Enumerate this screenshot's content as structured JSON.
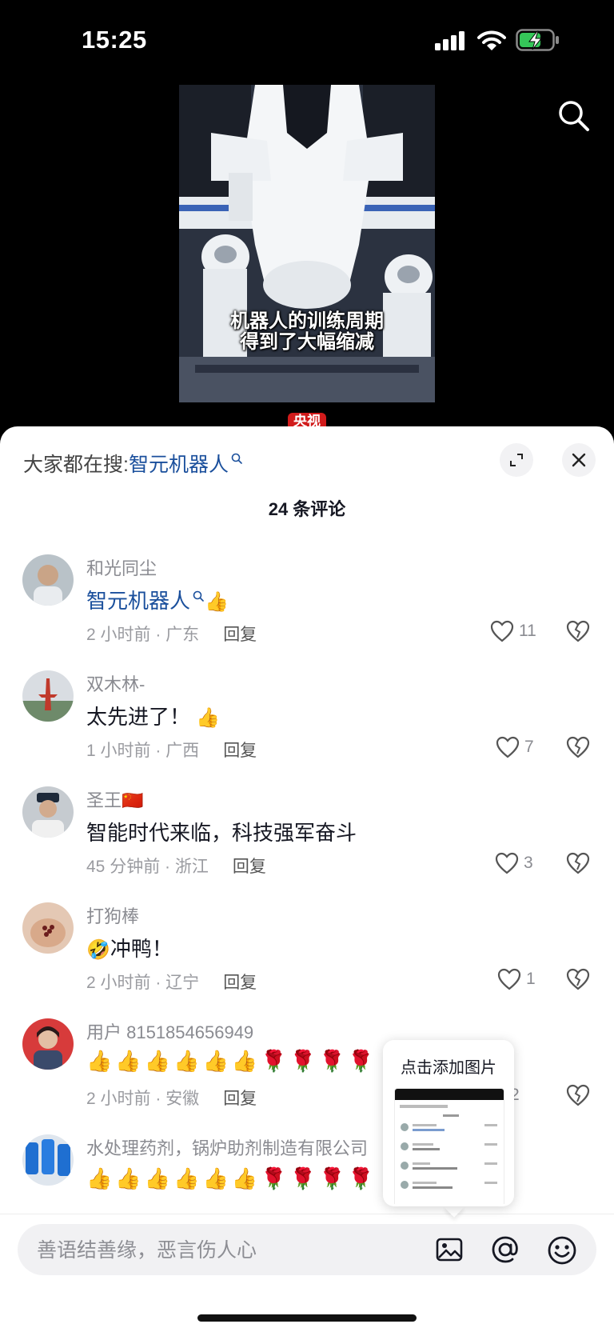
{
  "status_bar": {
    "time": "15:25"
  },
  "video": {
    "caption_line1": "机器人的训练周期",
    "caption_line2": "得到了大幅缩减",
    "source_badge": "央视"
  },
  "sheet": {
    "hot_search_prefix": "大家都在搜:",
    "hot_search_keyword": "智元机器人",
    "comment_count": "24 条评论"
  },
  "comments": [
    {
      "name": "和光同尘",
      "text_keyword": "智元机器人",
      "emoji": "👍",
      "time_location": "2 小时前 · 广东",
      "reply_label": "回复",
      "likes": "11"
    },
    {
      "name": "双木林-",
      "text": "太先进了！",
      "emoji": "👍",
      "time_location": "1 小时前 · 广西",
      "reply_label": "回复",
      "likes": "7"
    },
    {
      "name": "圣王",
      "flag": "🇨🇳",
      "text": "智能时代来临，科技强军奋斗",
      "time_location": "45 分钟前 · 浙江",
      "reply_label": "回复",
      "likes": "3"
    },
    {
      "name": "打狗棒",
      "emoji": "🤣",
      "text": "冲鸭！",
      "time_location": "2 小时前 · 辽宁",
      "reply_label": "回复",
      "likes": "1"
    },
    {
      "name": "用户 8151854656949",
      "emoji_row": "👍👍👍👍👍👍🌹🌹🌹🌹",
      "time_location": "2 小时前 · 安徽",
      "reply_label": "回复",
      "likes": "2"
    },
    {
      "name": "水处理药剂，锅炉助剂制造有限公司",
      "emoji_row": "👍👍👍👍👍👍🌹🌹🌹🌹"
    }
  ],
  "popup": {
    "title": "点击添加图片"
  },
  "input_bar": {
    "placeholder": "善语结善缘，恶言伤人心"
  },
  "icons": {
    "search": "search-icon",
    "expand": "expand-icon",
    "close": "close-icon",
    "like": "heart-outline-icon",
    "dislike": "broken-heart-icon",
    "image": "image-icon",
    "mention": "at-icon",
    "emoji": "smiley-icon"
  }
}
